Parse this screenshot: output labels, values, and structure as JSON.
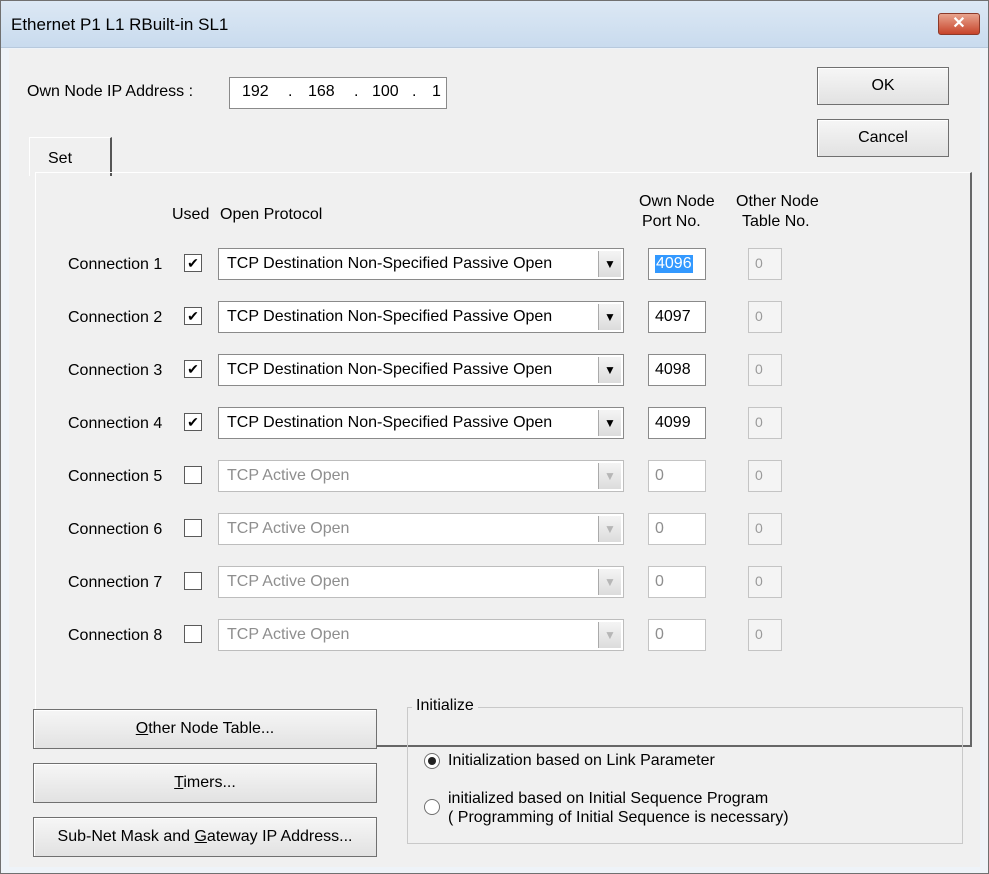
{
  "window": {
    "title": "Ethernet  P1 L1 RBuilt-in SL1",
    "close_glyph": "✕"
  },
  "ip": {
    "label": "Own Node IP Address :",
    "octets": [
      "192",
      "168",
      "100",
      "1"
    ],
    "separator": "."
  },
  "buttons": {
    "ok": "OK",
    "cancel": "Cancel",
    "other_node_table": {
      "accel": "O",
      "rest": "ther Node Table..."
    },
    "timers": {
      "accel": "T",
      "rest": "imers..."
    },
    "subnet": {
      "pre": "Sub-Net Mask and ",
      "accel": "G",
      "rest": "ateway IP Address..."
    }
  },
  "tab": {
    "label": "Set"
  },
  "headers": {
    "used": "Used",
    "open_protocol": "Open Protocol",
    "own_node_port": [
      "Own Node",
      "Port No."
    ],
    "other_node_table": [
      "Other Node",
      "Table No."
    ]
  },
  "connections": [
    {
      "label": "Connection 1",
      "used": true,
      "protocol": "TCP Destination Non-Specified Passive Open",
      "port": "4096",
      "table": "0",
      "enabled": true,
      "selected": true
    },
    {
      "label": "Connection 2",
      "used": true,
      "protocol": "TCP Destination Non-Specified Passive Open",
      "port": "4097",
      "table": "0",
      "enabled": true
    },
    {
      "label": "Connection 3",
      "used": true,
      "protocol": "TCP Destination Non-Specified Passive Open",
      "port": "4098",
      "table": "0",
      "enabled": true
    },
    {
      "label": "Connection 4",
      "used": true,
      "protocol": "TCP Destination Non-Specified Passive Open",
      "port": "4099",
      "table": "0",
      "enabled": true
    },
    {
      "label": "Connection 5",
      "used": false,
      "protocol": "TCP Active Open",
      "port": "0",
      "table": "0",
      "enabled": false
    },
    {
      "label": "Connection 6",
      "used": false,
      "protocol": "TCP Active Open",
      "port": "0",
      "table": "0",
      "enabled": false
    },
    {
      "label": "Connection 7",
      "used": false,
      "protocol": "TCP Active Open",
      "port": "0",
      "table": "0",
      "enabled": false
    },
    {
      "label": "Connection 8",
      "used": false,
      "protocol": "TCP Active Open",
      "port": "0",
      "table": "0",
      "enabled": false
    }
  ],
  "initialize": {
    "legend": "Initialize",
    "option1": "Initialization based on Link Parameter",
    "option2_line1": "initialized based on Initial Sequence Program",
    "option2_line2": "( Programming of Initial Sequence is necessary)",
    "selected": 1
  },
  "icons": {
    "check": "✔",
    "dropdown": "▼"
  }
}
